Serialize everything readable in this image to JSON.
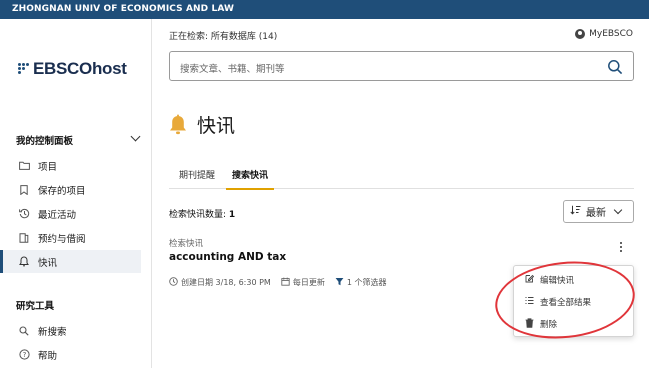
{
  "top_banner": {
    "text": "ZHONGNAN UNIV OF ECONOMICS AND LAW",
    "color": "#1f4e79"
  },
  "logo": {
    "text": "EBSCOhost"
  },
  "sidebar": {
    "dashboard_heading": "我的控制面板",
    "dashboard_items": [
      {
        "label": "项目",
        "icon": "folder-icon"
      },
      {
        "label": "保存的项目",
        "icon": "bookmark-icon"
      },
      {
        "label": "最近活动",
        "icon": "history-icon"
      },
      {
        "label": "预约与借阅",
        "icon": "book-icon"
      },
      {
        "label": "快讯",
        "icon": "bell-icon",
        "active": true
      }
    ],
    "tools_heading": "研究工具",
    "tools_items": [
      {
        "label": "新搜索",
        "icon": "search-icon"
      },
      {
        "label": "帮助",
        "icon": "help-icon"
      }
    ]
  },
  "header": {
    "status": "正在检索: 所有数据库 (14)",
    "account_label": "MyEBSCO",
    "search_placeholder": "搜索文章、书籍、期刊等"
  },
  "page": {
    "title": "快讯",
    "tabs": [
      {
        "label": "期刊提醒",
        "active": false
      },
      {
        "label": "搜索快讯",
        "active": true
      }
    ],
    "count_label": "检索快讯数量:",
    "count_value": "1",
    "sort_label": "最新"
  },
  "alert": {
    "kind": "检索快讯",
    "title": "accounting AND tax",
    "created": "创建日期 3/18, 6:30 PM",
    "frequency": "每日更新",
    "filters": "1 个筛选器"
  },
  "menu": {
    "items": [
      {
        "label": "编辑快讯",
        "icon": "edit-icon"
      },
      {
        "label": "查看全部结果",
        "icon": "list-icon"
      },
      {
        "label": "删除",
        "icon": "trash-icon"
      }
    ]
  },
  "colors": {
    "accent": "#e0a100",
    "highlight": "#e0353a",
    "brand": "#1f4e79"
  }
}
